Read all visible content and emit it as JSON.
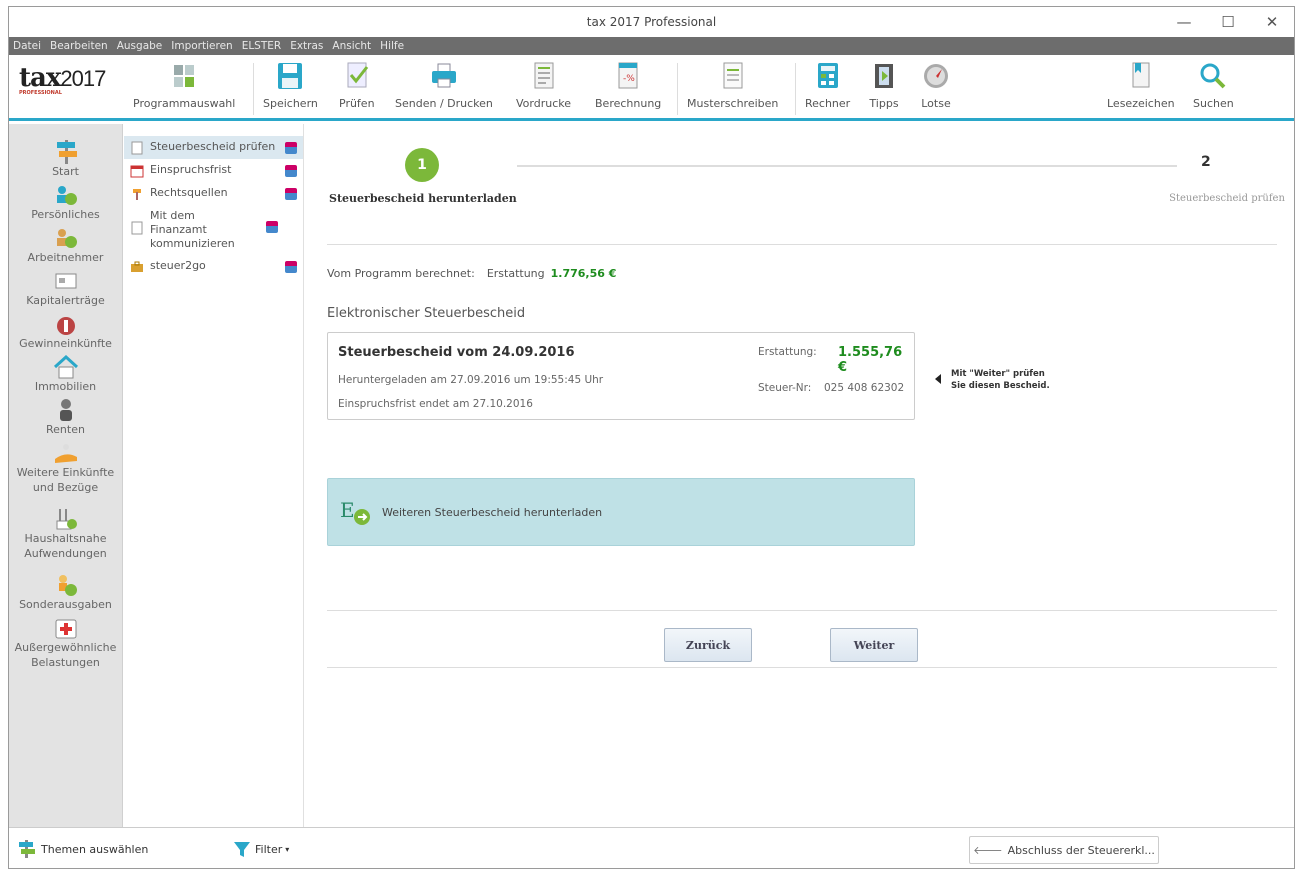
{
  "window": {
    "title": "tax 2017 Professional",
    "min": "—",
    "max": "☐",
    "close": "✕"
  },
  "menu": [
    "Datei",
    "Bearbeiten",
    "Ausgabe",
    "Importieren",
    "ELSTER",
    "Extras",
    "Ansicht",
    "Hilfe"
  ],
  "logo": {
    "main": "tax",
    "year": "2017",
    "sub": "PROFESSIONAL"
  },
  "toolbar": {
    "programmauswahl": "Programmauswahl",
    "speichern": "Speichern",
    "pruefen": "Prüfen",
    "senden": "Senden / Drucken",
    "vordrucke": "Vordrucke",
    "berechnung": "Berechnung",
    "musterschreiben": "Musterschreiben",
    "rechner": "Rechner",
    "tipps": "Tipps",
    "lotse": "Lotse",
    "lesezeichen": "Lesezeichen",
    "suchen": "Suchen"
  },
  "sidebar": [
    {
      "label": "Start"
    },
    {
      "label": "Persönliches"
    },
    {
      "label": "Arbeitnehmer"
    },
    {
      "label": "Kapitalerträge"
    },
    {
      "label": "Gewinneinkünfte"
    },
    {
      "label": "Immobilien"
    },
    {
      "label": "Renten"
    },
    {
      "label": "Weitere Einkünfte und Bezüge"
    },
    {
      "label": "Haushaltsnahe Aufwendungen"
    },
    {
      "label": "Sonderausgaben"
    },
    {
      "label": "Außergewöhnliche Belastungen"
    }
  ],
  "subnav": [
    {
      "label": "Steuerbescheid prüfen"
    },
    {
      "label": "Einspruchsfrist"
    },
    {
      "label": "Rechtsquellen"
    },
    {
      "label": "Mit dem Finanzamt kommunizieren"
    },
    {
      "label": "steuer2go"
    }
  ],
  "steps": {
    "step1_num": "1",
    "step1_label": "Steuerbescheid herunterladen",
    "step2_num": "2",
    "step2_label": "Steuerbescheid prüfen"
  },
  "calc": {
    "prefix": "Vom Programm berechnet:",
    "label": "Erstattung",
    "amount": "1.776,56 €"
  },
  "section_title": "Elektronischer Steuerbescheid",
  "card": {
    "title": "Steuerbescheid vom 24.09.2016",
    "downloaded": "Heruntergeladen am 27.09.2016 um 19:55:45 Uhr",
    "deadline": "Einspruchsfrist endet am 27.10.2016",
    "erstattung_label": "Erstattung:",
    "erstattung_value": "1.555,76 €",
    "steuernr_label": "Steuer-Nr:",
    "steuernr_value": "025 408 62302"
  },
  "hint": {
    "line1": "Mit \"Weiter\" prüfen",
    "line2": "Sie diesen Bescheid."
  },
  "download_more": "Weiteren Steuerbescheid herunterladen",
  "buttons": {
    "back": "Zurück",
    "next": "Weiter"
  },
  "bottom": {
    "themen": "Themen auswählen",
    "filter": "Filter",
    "abschluss": "Abschluss der Steuererkl..."
  },
  "colors": {
    "accent": "#2aa7c9",
    "green": "#1e8c1e",
    "step": "#7cb83a"
  }
}
